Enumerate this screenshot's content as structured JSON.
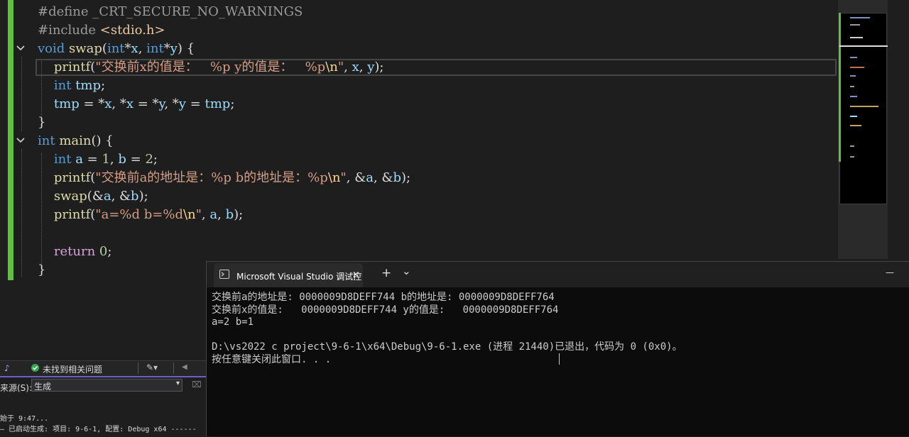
{
  "editor": {
    "lines": [
      {
        "tokens": [
          {
            "t": "#define ",
            "c": "pp"
          },
          {
            "t": "_CRT_SECURE_NO_WARNINGS",
            "c": "pp"
          }
        ]
      },
      {
        "tokens": [
          {
            "t": "#include ",
            "c": "pp"
          },
          {
            "t": "<stdio.h>",
            "c": "inc"
          }
        ]
      },
      {
        "tokens": [
          {
            "t": "void ",
            "c": "kw"
          },
          {
            "t": "swap",
            "c": "fn"
          },
          {
            "t": "(",
            "c": "pun"
          },
          {
            "t": "int",
            "c": "kw"
          },
          {
            "t": "*",
            "c": "pun"
          },
          {
            "t": "x",
            "c": "var"
          },
          {
            "t": ", ",
            "c": "pun"
          },
          {
            "t": "int",
            "c": "kw"
          },
          {
            "t": "*",
            "c": "pun"
          },
          {
            "t": "y",
            "c": "var"
          },
          {
            "t": ") {",
            "c": "pun"
          }
        ]
      },
      {
        "tokens": [
          {
            "t": "    printf",
            "c": "fn"
          },
          {
            "t": "(",
            "c": "pun"
          },
          {
            "t": "\"交换前x的值是：  ",
            "c": "str"
          },
          {
            "t": " %p y的值是：  ",
            "c": "str"
          },
          {
            "t": " %p",
            "c": "str"
          },
          {
            "t": "\\n",
            "c": "esc"
          },
          {
            "t": "\"",
            "c": "str"
          },
          {
            "t": ", ",
            "c": "pun"
          },
          {
            "t": "x",
            "c": "var"
          },
          {
            "t": ", ",
            "c": "pun"
          },
          {
            "t": "y",
            "c": "var"
          },
          {
            "t": ");",
            "c": "pun"
          }
        ]
      },
      {
        "tokens": [
          {
            "t": "    int ",
            "c": "kw"
          },
          {
            "t": "tmp",
            "c": "var"
          },
          {
            "t": ";",
            "c": "pun"
          }
        ]
      },
      {
        "tokens": [
          {
            "t": "    tmp",
            "c": "var"
          },
          {
            "t": " = *",
            "c": "pun"
          },
          {
            "t": "x",
            "c": "var"
          },
          {
            "t": ", *",
            "c": "pun"
          },
          {
            "t": "x",
            "c": "var"
          },
          {
            "t": " = *",
            "c": "pun"
          },
          {
            "t": "y",
            "c": "var"
          },
          {
            "t": ", *",
            "c": "pun"
          },
          {
            "t": "y",
            "c": "var"
          },
          {
            "t": " = ",
            "c": "pun"
          },
          {
            "t": "tmp",
            "c": "var"
          },
          {
            "t": ";",
            "c": "pun"
          }
        ]
      },
      {
        "tokens": [
          {
            "t": "}",
            "c": "pun"
          }
        ]
      },
      {
        "tokens": [
          {
            "t": "int ",
            "c": "kw"
          },
          {
            "t": "main",
            "c": "fn"
          },
          {
            "t": "() {",
            "c": "pun"
          }
        ]
      },
      {
        "tokens": [
          {
            "t": "    int ",
            "c": "kw"
          },
          {
            "t": "a",
            "c": "var"
          },
          {
            "t": " = ",
            "c": "pun"
          },
          {
            "t": "1",
            "c": "num"
          },
          {
            "t": ", ",
            "c": "pun"
          },
          {
            "t": "b",
            "c": "var"
          },
          {
            "t": " = ",
            "c": "pun"
          },
          {
            "t": "2",
            "c": "num"
          },
          {
            "t": ";",
            "c": "pun"
          }
        ]
      },
      {
        "tokens": [
          {
            "t": "    printf",
            "c": "fn"
          },
          {
            "t": "(",
            "c": "pun"
          },
          {
            "t": "\"交换前a的地址是：%p b的地址是：%p",
            "c": "str"
          },
          {
            "t": "\\n",
            "c": "esc"
          },
          {
            "t": "\"",
            "c": "str"
          },
          {
            "t": ", &",
            "c": "pun"
          },
          {
            "t": "a",
            "c": "var"
          },
          {
            "t": ", &",
            "c": "pun"
          },
          {
            "t": "b",
            "c": "var"
          },
          {
            "t": ");",
            "c": "pun"
          }
        ]
      },
      {
        "tokens": [
          {
            "t": "    swap",
            "c": "fn"
          },
          {
            "t": "(&",
            "c": "pun"
          },
          {
            "t": "a",
            "c": "var"
          },
          {
            "t": ", &",
            "c": "pun"
          },
          {
            "t": "b",
            "c": "var"
          },
          {
            "t": ");",
            "c": "pun"
          }
        ]
      },
      {
        "tokens": [
          {
            "t": "    printf",
            "c": "fn"
          },
          {
            "t": "(",
            "c": "pun"
          },
          {
            "t": "\"a=%d b=%d",
            "c": "str"
          },
          {
            "t": "\\n",
            "c": "esc"
          },
          {
            "t": "\"",
            "c": "str"
          },
          {
            "t": ", ",
            "c": "pun"
          },
          {
            "t": "a",
            "c": "var"
          },
          {
            "t": ", ",
            "c": "pun"
          },
          {
            "t": "b",
            "c": "var"
          },
          {
            "t": ");",
            "c": "pun"
          }
        ]
      },
      {
        "tokens": []
      },
      {
        "tokens": [
          {
            "t": "    return ",
            "c": "kw2"
          },
          {
            "t": "0",
            "c": "num"
          },
          {
            "t": ";",
            "c": "pun"
          }
        ]
      },
      {
        "tokens": [
          {
            "t": "}",
            "c": "pun"
          }
        ]
      }
    ]
  },
  "status_strip": {
    "issues_text": "未找到相关问题"
  },
  "output_panel": {
    "source_label": "来源(S):",
    "source_value": "生成",
    "line1": "始于 9:47...",
    "line2": "— 已启动生成: 项目: 9-6-1, 配置: Debug x64 ------"
  },
  "console": {
    "tab_title": "Microsoft Visual Studio 调试控",
    "close_symbol": "✕",
    "new_tab_symbol": "+",
    "dropdown_symbol": "⌄",
    "minimize_symbol": "—",
    "output_lines": [
      "交换前a的地址是: 0000009D8DEFF744 b的地址是: 0000009D8DEFF764",
      "交换前x的值是:   0000009D8DEFF744 y的值是:   0000009D8DEFF764",
      "a=2 b=1",
      "",
      "D:\\vs2022 c project\\9-6-1\\x64\\Debug\\9-6-1.exe (进程 21440)已退出，代码为 0 (0x0)。",
      "按任意键关闭此窗口. . ."
    ]
  },
  "colors": {
    "editor_bg": "#1e1e1e",
    "change_marker": "#5fbf3f",
    "console_bg": "#0c0c0c",
    "keyword": "#569cd6",
    "string": "#d69d85",
    "function": "#dcdcaa"
  }
}
